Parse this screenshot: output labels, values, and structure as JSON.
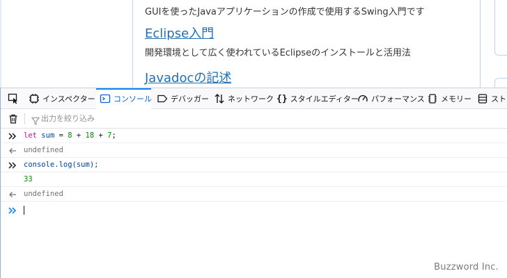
{
  "page": {
    "article_1_desc": "GUIを使ったJavaアプリケーションの作成で使用するSwing入門です",
    "article_2_title": "Eclipse入門",
    "article_2_desc": "開発環境として広く使われているEclipseのインストールと活用法",
    "article_3_title": "Javadocの記述"
  },
  "devtools": {
    "tabs": [
      {
        "label": "",
        "icon": "element-picker-icon"
      },
      {
        "label": "インスペクター",
        "icon": "inspector-icon"
      },
      {
        "label": "コンソール",
        "icon": "console-icon",
        "selected": true
      },
      {
        "label": "デバッガー",
        "icon": "debugger-icon"
      },
      {
        "label": "ネットワーク",
        "icon": "network-icon"
      },
      {
        "label": "スタイルエディター",
        "icon": "style-editor-icon"
      },
      {
        "label": "パフォーマンス",
        "icon": "performance-icon"
      },
      {
        "label": "メモリー",
        "icon": "memory-icon"
      },
      {
        "label": "ストレ",
        "icon": "storage-icon"
      }
    ],
    "filter_placeholder": "出力を絞り込み",
    "console": {
      "rows": [
        {
          "kind": "input",
          "parts": {
            "kw": "let",
            "id": "sum",
            "eq": " = ",
            "n1": "8",
            "p1": " + ",
            "n2": "18",
            "p2": " + ",
            "n3": "7",
            "end": ";"
          }
        },
        {
          "kind": "result",
          "text": "undefined"
        },
        {
          "kind": "input",
          "text": "console.log(sum);"
        },
        {
          "kind": "log",
          "text": "33"
        },
        {
          "kind": "result",
          "text": "undefined"
        }
      ],
      "prompt_value": ""
    },
    "colors": {
      "accent": "#0a84ff",
      "keyword": "#dd00a9",
      "identifier": "#0042a3",
      "number": "#058b00",
      "undefined": "#737373"
    }
  },
  "watermark": "Buzzword Inc."
}
